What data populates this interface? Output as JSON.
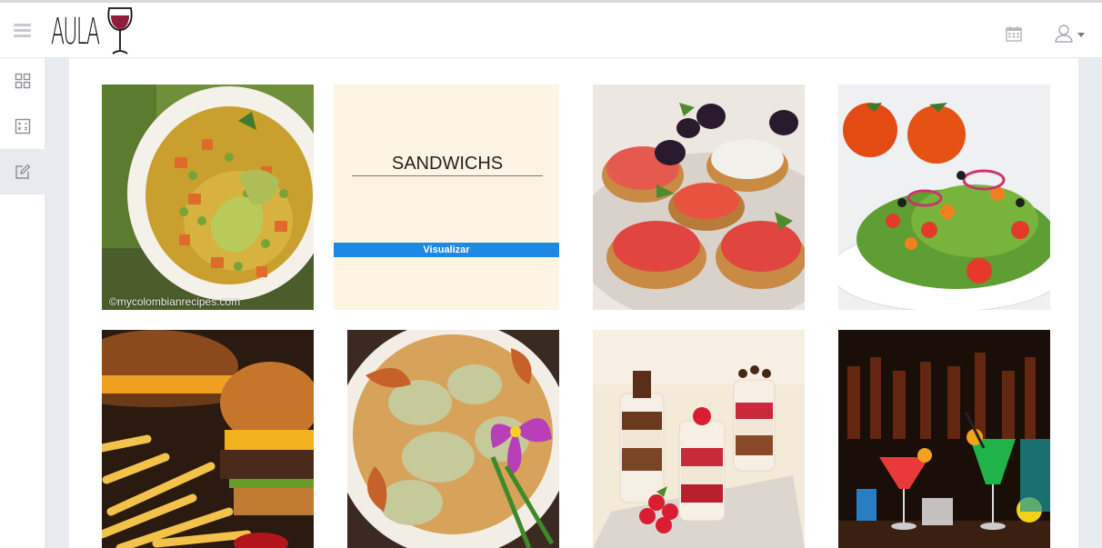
{
  "header": {
    "logo_text": "AULA",
    "icons": [
      "menu-icon",
      "calendar-icon",
      "user-icon",
      "caret-down-icon"
    ]
  },
  "sidebar": {
    "items": [
      {
        "icon": "grid-icon",
        "active": false
      },
      {
        "icon": "calculator-icon",
        "active": false
      },
      {
        "icon": "edit-icon",
        "active": true
      }
    ]
  },
  "tiles": [
    {
      "name": "soup",
      "caption": "©mycolombianrecipes.com"
    },
    {
      "name": "sandwiches",
      "title": "SANDWICHS",
      "button": "Visualizar"
    },
    {
      "name": "bruschetta",
      "caption": ""
    },
    {
      "name": "salad",
      "caption": ""
    },
    {
      "name": "burger",
      "caption": ""
    },
    {
      "name": "crab",
      "caption": ""
    },
    {
      "name": "dessert",
      "caption": ""
    },
    {
      "name": "cocktails",
      "caption": ""
    }
  ],
  "colors": {
    "accent": "#1e88e5",
    "featured_bg": "#fdf4e3",
    "page_bg": "#e8ecf1"
  }
}
